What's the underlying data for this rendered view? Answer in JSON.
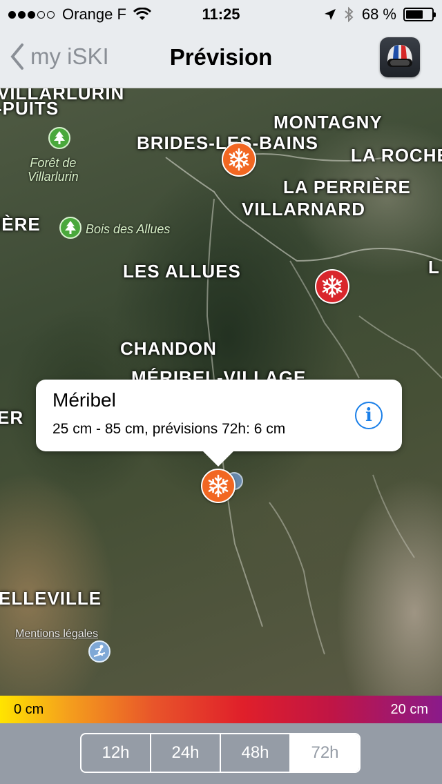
{
  "status_bar": {
    "carrier": "Orange F",
    "signal_bars_filled": 3,
    "signal_bars_total": 5,
    "time": "11:25",
    "battery_percent": "68 %",
    "battery_level": 0.68
  },
  "nav": {
    "back_label": "my iSKI",
    "title": "Prévision",
    "app_icon": "helmet-goggles-icon"
  },
  "map": {
    "places": {
      "villarlurin": "VILLARLURIN",
      "puits": "-PUITS",
      "brides": "BRIDES-LES-BAINS",
      "montagny": "MONTAGNY",
      "la_roche": "LA ROCHE",
      "la_perriere": "LA PERRIÈRE",
      "villarnard": "VILLARNARD",
      "iere": "IÈRE",
      "les_allues": "LES ALLUES",
      "chandon": "CHANDON",
      "meribel_village": "MÉRIBEL-VILLAGE",
      "er": "ER",
      "elleville": "ELLEVILLE",
      "l": "L"
    },
    "pois": {
      "foret_line1": "Forêt de",
      "foret_line2": "Villarlurin",
      "bois": "Bois des Allues"
    },
    "callout": {
      "title": "Méribel",
      "subtitle": "25 cm - 85 cm, prévisions 72h: 6 cm"
    },
    "legal": "Mentions légales",
    "marker_colors": {
      "orange": "#f26722",
      "red": "#d9262c"
    }
  },
  "scale": {
    "min_label": "0 cm",
    "max_label": "20 cm"
  },
  "segments": {
    "items": [
      "12h",
      "24h",
      "48h",
      "72h"
    ],
    "selected": "72h"
  }
}
